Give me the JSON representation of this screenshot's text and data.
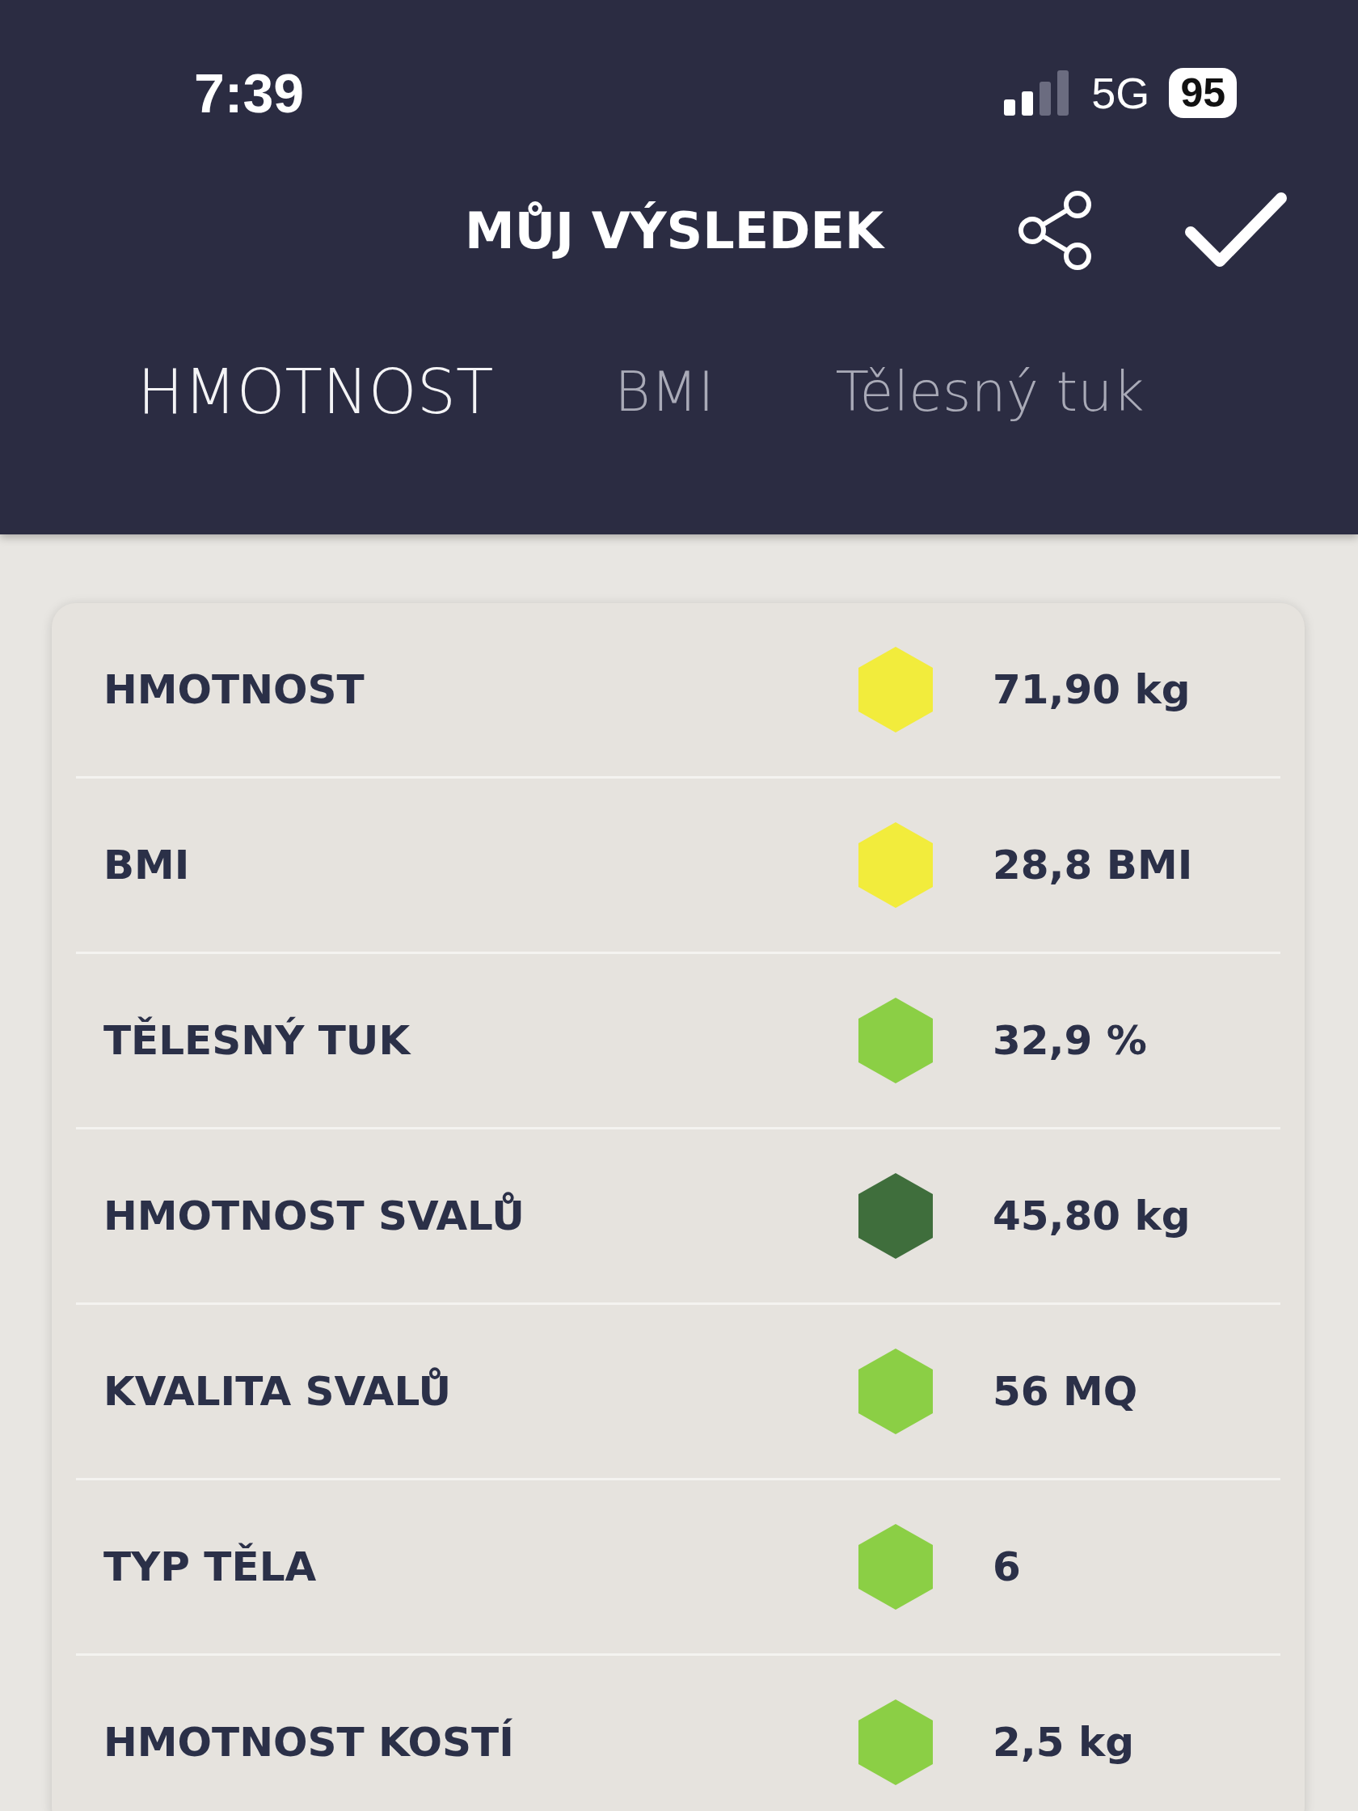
{
  "status_bar": {
    "time": "7:39",
    "network": "5G",
    "battery": "95"
  },
  "header": {
    "title": "MŮJ VÝSLEDEK"
  },
  "tabs": [
    {
      "label": "HMOTNOST",
      "selected": true
    },
    {
      "label": "BMI",
      "selected": false
    },
    {
      "label": "Tělesný tuk",
      "selected": false
    }
  ],
  "results": [
    {
      "label": "HMOTNOST",
      "color": "#f2ec3c",
      "value": "71,90 kg"
    },
    {
      "label": "BMI",
      "color": "#f2ec3c",
      "value": "28,8 BMI"
    },
    {
      "label": "TĚLESNÝ TUK",
      "color": "#8bcf45",
      "value": "32,9 %"
    },
    {
      "label": "HMOTNOST SVALŮ",
      "color": "#3f6e3c",
      "value": "45,80 kg"
    },
    {
      "label": "KVALITA SVALŮ",
      "color": "#8bcf45",
      "value": "56 MQ"
    },
    {
      "label": "TYP TĚLA",
      "color": "#8bcf45",
      "value": "6"
    },
    {
      "label": "HMOTNOST KOSTÍ",
      "color": "#8bcf45",
      "value": "2,5 kg"
    }
  ]
}
